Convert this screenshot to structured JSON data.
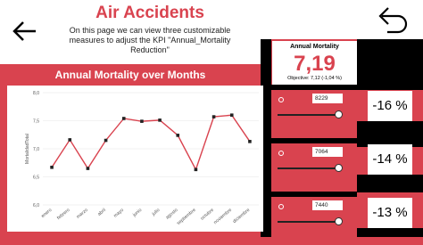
{
  "header": {
    "title": "Air Accidents",
    "description": "On this page we can view three customizable measures to adjust the KPI \"Annual_Mortality Reduction\""
  },
  "chart_data": {
    "type": "line",
    "title": "Annual Mortality over Months",
    "ylabel": "MortalidadTotal",
    "categories": [
      "enero",
      "febrero",
      "marzo",
      "abril",
      "mayo",
      "junio",
      "julio",
      "agosto",
      "septiembre",
      "octubre",
      "noviembre",
      "diciembre"
    ],
    "values": [
      6.67,
      7.16,
      6.65,
      7.15,
      7.54,
      7.49,
      7.51,
      7.24,
      6.63,
      7.57,
      7.6,
      7.13
    ],
    "ylim": [
      6.0,
      8.0
    ],
    "yticks": [
      "6,0",
      "6,5",
      "7,0",
      "7,5",
      "8,0"
    ],
    "line_color": "#d9434f",
    "grid": true
  },
  "kpi": {
    "label": "Annual Mortality",
    "value": "7,19",
    "objective": "Objective: 7,12 (-1,04 %)"
  },
  "sliders": [
    {
      "value": "8229",
      "percent": "-16 %",
      "level": 0.95
    },
    {
      "value": "7064",
      "percent": "-14 %",
      "level": 0.95
    },
    {
      "value": "7440",
      "percent": "-13 %",
      "level": 0.95
    }
  ],
  "colors": {
    "brand": "#d9434f",
    "background": "#ffffff",
    "panel": "#000000"
  },
  "icons": {
    "back": "back-arrow-icon"
  }
}
